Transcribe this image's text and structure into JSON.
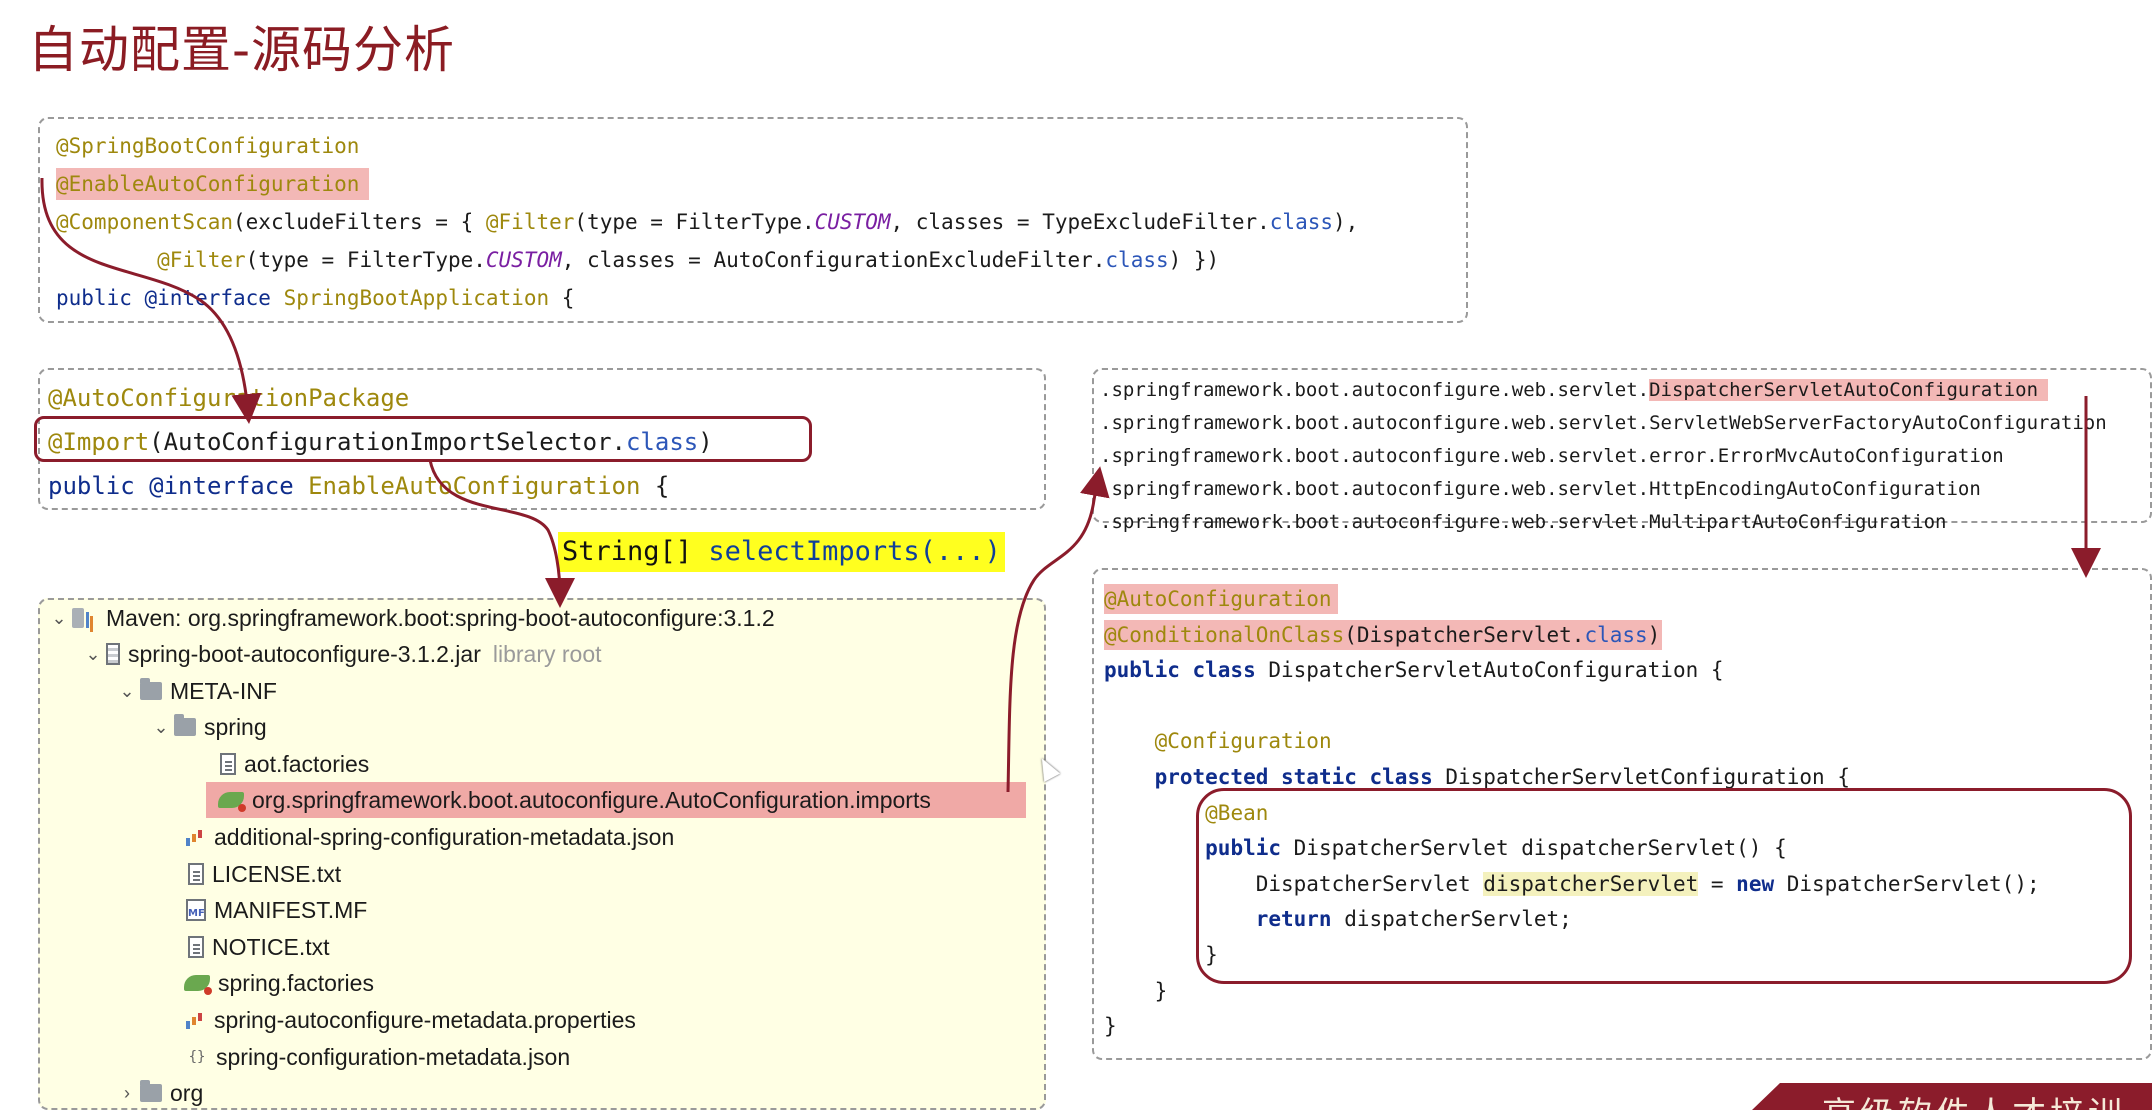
{
  "page": {
    "title": "自动配置-源码分析"
  },
  "springBootApp": {
    "line1": "@SpringBootConfiguration",
    "line2": "@EnableAutoConfiguration",
    "line3_ann": "@ComponentScan",
    "line3_a": "(excludeFilters = { ",
    "line3_filter": "@Filter",
    "line3_b": "(type = FilterType.",
    "line3_custom": "CUSTOM",
    "line3_c": ", classes = TypeExcludeFilter.",
    "line3_class": "class",
    "line3_d": "),",
    "line4_filter": "@Filter",
    "line4_a": "(type = FilterType.",
    "line4_custom": "CUSTOM",
    "line4_b": ", classes = AutoConfigurationExcludeFilter.",
    "line4_class": "class",
    "line4_c": ") })",
    "line5_public": "public",
    "line5_iface": "@interface",
    "line5_name": "SpringBootApplication",
    "line5_brace": " {"
  },
  "enableAuto": {
    "line1": "@AutoConfigurationPackage",
    "line2_ann": "@Import",
    "line2_a": "(AutoConfigurationImportSelector.",
    "line2_class": "class",
    "line2_b": ")",
    "line3_public": "public",
    "line3_iface": "@interface",
    "line3_name": "EnableAutoConfiguration",
    "line3_brace": " {"
  },
  "selectImports": {
    "type": "String[] ",
    "method": "selectImports(...)"
  },
  "importsList": [
    {
      "prefix": ".springframework.boot.autoconfigure.web.servlet.",
      "name": "DispatcherServletAutoConfiguration"
    },
    {
      "prefix": ".springframework.boot.autoconfigure.web.servlet.",
      "name": "ServletWebServerFactoryAutoConfiguration"
    },
    {
      "prefix": ".springframework.boot.autoconfigure.web.servlet.",
      "name": "error.ErrorMvcAutoConfiguration"
    },
    {
      "prefix": ".springframework.boot.autoconfigure.web.servlet.",
      "name": "HttpEncodingAutoConfiguration"
    },
    {
      "prefix": ".springframework.boot.autoconfigure.web.servlet.",
      "name": "MultipartAutoConfiguration"
    }
  ],
  "dispatcherCode": {
    "l1": "@AutoConfiguration",
    "l2_ann": "@ConditionalOnClass",
    "l2_a": "(DispatcherServlet.",
    "l2_class": "class",
    "l2_b": ")",
    "l3_kw": "public class",
    "l3_rest": " DispatcherServletAutoConfiguration {",
    "l5": "@Configuration",
    "l6_kw": "protected static class",
    "l6_rest": " DispatcherServletConfiguration {",
    "l7": "@Bean",
    "l8_kw": "public",
    "l8_rest": " DispatcherServlet dispatcherServlet() {",
    "l9_a": "DispatcherServlet ",
    "l9_var": "dispatcherServlet",
    "l9_b": " = ",
    "l9_new": "new",
    "l9_c": " DispatcherServlet();",
    "l10_kw": "return",
    "l10_rest": " dispatcherServlet;",
    "l11": "}",
    "l12": "}",
    "l13": "}"
  },
  "tree": [
    {
      "name": "Maven: org.springframework.boot:spring-boot-autoconfigure:3.1.2",
      "extra": ""
    },
    {
      "name": "spring-boot-autoconfigure-3.1.2.jar",
      "extra": "library root"
    },
    {
      "name": "META-INF",
      "extra": ""
    },
    {
      "name": "spring",
      "extra": ""
    },
    {
      "name": "aot.factories",
      "extra": ""
    },
    {
      "name": "org.springframework.boot.autoconfigure.AutoConfiguration.imports",
      "extra": ""
    },
    {
      "name": "additional-spring-configuration-metadata.json",
      "extra": ""
    },
    {
      "name": "LICENSE.txt",
      "extra": ""
    },
    {
      "name": "MANIFEST.MF",
      "extra": ""
    },
    {
      "name": "NOTICE.txt",
      "extra": ""
    },
    {
      "name": "spring.factories",
      "extra": ""
    },
    {
      "name": "spring-autoconfigure-metadata.properties",
      "extra": ""
    },
    {
      "name": "spring-configuration-metadata.json",
      "extra": ""
    },
    {
      "name": "org",
      "extra": ""
    }
  ],
  "icons": {
    "mf_badge": "MF",
    "json_badge": "{}"
  },
  "banner": {
    "text": "高级软件人才培训"
  },
  "colors": {
    "accent": "#8b1c23",
    "highlight": "#f3b8b6",
    "yellow": "#ffff1f",
    "treeBg": "#ffffe4"
  }
}
